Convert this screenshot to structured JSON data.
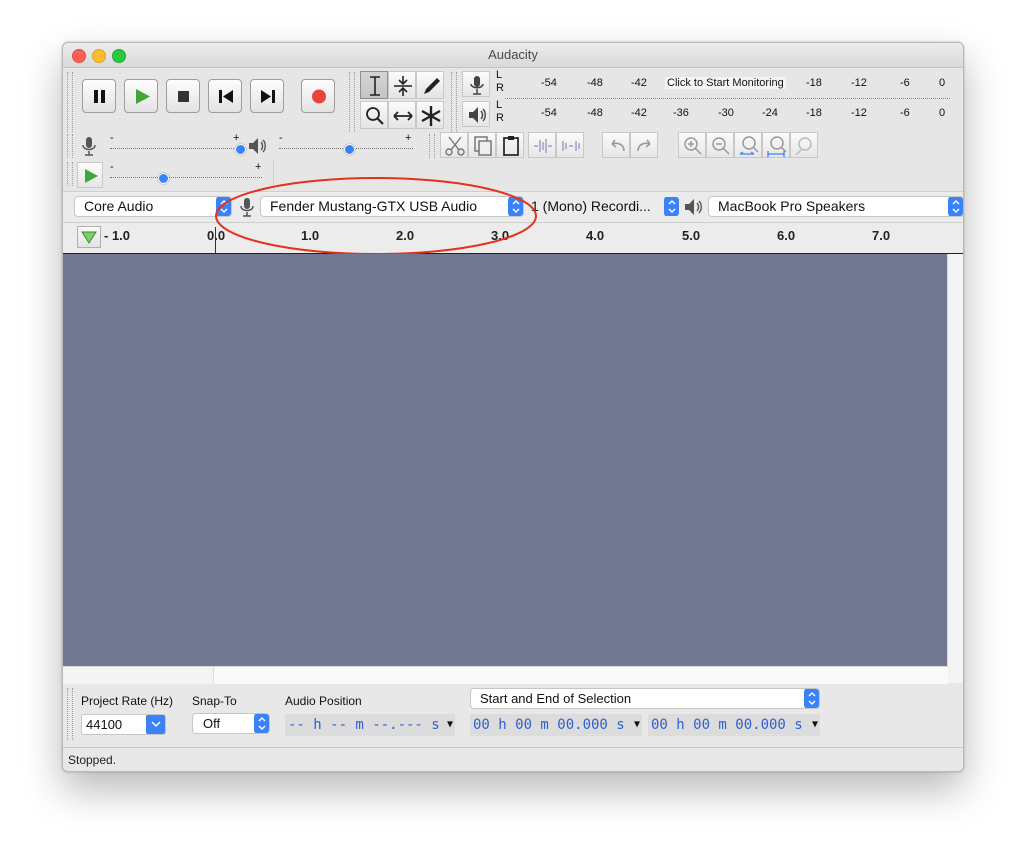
{
  "window": {
    "title": "Audacity"
  },
  "transport": {
    "buttons": [
      "pause",
      "play",
      "stop",
      "skip-to-start",
      "skip-to-end",
      "record"
    ]
  },
  "meters": {
    "record": {
      "channels": [
        "L",
        "R"
      ],
      "ticks": [
        "-54",
        "-48",
        "-42",
        "-18",
        "-12",
        "-6",
        "0"
      ],
      "monitor_label": "Click to Start Monitoring"
    },
    "playback": {
      "channels": [
        "L",
        "R"
      ],
      "ticks": [
        "-54",
        "-48",
        "-42",
        "-36",
        "-30",
        "-24",
        "-18",
        "-12",
        "-6",
        "0"
      ]
    }
  },
  "mixer": {
    "record_volume_marks": [
      "-",
      "+"
    ],
    "playback_volume_marks": [
      "-",
      "+"
    ],
    "play_at_speed_marks": [
      "-",
      "+"
    ]
  },
  "device": {
    "host": "Core Audio",
    "input_device": "Fender Mustang-GTX USB Audio",
    "input_channels": "1 (Mono) Recordi...",
    "output_device": "MacBook Pro Speakers"
  },
  "ruler": {
    "labels": [
      "- 1.0",
      "0.0",
      "1.0",
      "2.0",
      "3.0",
      "4.0",
      "5.0",
      "6.0",
      "7.0"
    ]
  },
  "colors": {
    "track_area": "#727891",
    "record_red": "#e8463c",
    "play_green": "#3fa63b",
    "select_blue": "#3a82f7",
    "annotation_red": "#e5321f"
  },
  "selection_toolbar": {
    "project_rate_label": "Project Rate (Hz)",
    "project_rate_value": "44100",
    "snap_to_label": "Snap-To",
    "snap_to_value": "Off",
    "audio_position_label": "Audio Position",
    "audio_position_value": "-- h -- m --.--- s",
    "selection_mode": "Start and End of Selection",
    "selection_start": "00 h 00 m 00.000 s",
    "selection_end": "00 h 00 m 00.000 s"
  },
  "status": {
    "text": "Stopped."
  }
}
